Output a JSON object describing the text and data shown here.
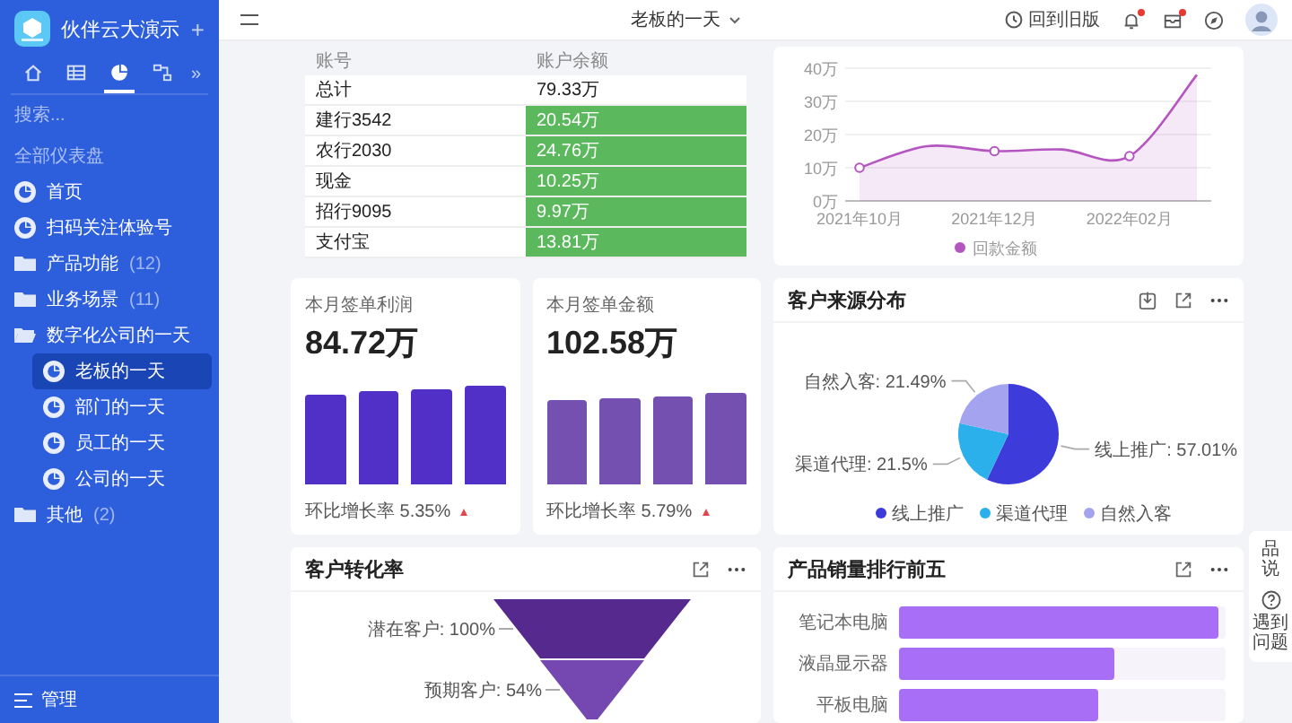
{
  "sidebar": {
    "brand": "伙伴云大演示",
    "add": "+",
    "tabs": [
      {
        "kind": "home",
        "selected": false
      },
      {
        "kind": "table",
        "selected": false
      },
      {
        "kind": "pie",
        "selected": true
      },
      {
        "kind": "flow",
        "selected": false
      }
    ],
    "more": "»",
    "search": {
      "placeholder": "搜索..."
    },
    "section": "全部仪表盘",
    "items": [
      {
        "kind": "dashboard",
        "label": "首页",
        "selected": false
      },
      {
        "kind": "dashboard",
        "label": "扫码关注体验号",
        "selected": false
      },
      {
        "kind": "folder",
        "label": "产品功能",
        "count": "(12)",
        "expanded": false
      },
      {
        "kind": "folder",
        "label": "业务场景",
        "count": "(11)",
        "expanded": false
      },
      {
        "kind": "folder",
        "label": "数字化公司的一天",
        "expanded": true,
        "children": [
          {
            "kind": "dashboard",
            "label": "老板的一天",
            "selected": true
          },
          {
            "kind": "dashboard",
            "label": "部门的一天",
            "selected": false
          },
          {
            "kind": "dashboard",
            "label": "员工的一天",
            "selected": false
          },
          {
            "kind": "dashboard",
            "label": "公司的一天",
            "selected": false
          }
        ]
      },
      {
        "kind": "folder",
        "label": "其他",
        "count": "(2)",
        "expanded": false
      }
    ],
    "footer": "管理"
  },
  "topbar": {
    "title": "老板的一天",
    "old_version": "回到旧版",
    "bell_badge": true,
    "inbox_badge": true
  },
  "balance_table": {
    "columns": [
      "账号",
      "账户余额"
    ],
    "rows": [
      {
        "account": "总计",
        "balance": "79.33万",
        "highlighted": false
      },
      {
        "account": "建行3542",
        "balance": "20.54万",
        "highlighted": true
      },
      {
        "account": "农行2030",
        "balance": "24.76万",
        "highlighted": true
      },
      {
        "account": "现金",
        "balance": "10.25万",
        "highlighted": true
      },
      {
        "account": "招行9095",
        "balance": "9.97万",
        "highlighted": true
      },
      {
        "account": "支付宝",
        "balance": "13.81万",
        "highlighted": true
      }
    ]
  },
  "payment_chart": {
    "chart_data": {
      "type": "area",
      "grid": true,
      "categories": [
        "2021年10月",
        null,
        "2021年12月",
        null,
        "2022年02月",
        null
      ],
      "ylim": [
        0,
        40
      ],
      "yticks": [
        {
          "value": 0,
          "label": "0万"
        },
        {
          "value": 10,
          "label": "10万"
        },
        {
          "value": 20,
          "label": "20万"
        },
        {
          "value": 30,
          "label": "30万"
        },
        {
          "value": 40,
          "label": "40万"
        }
      ],
      "series": [
        {
          "name": "回款金额",
          "color": "#b455c0",
          "values": [
            10,
            16.5,
            15,
            15.5,
            13.5,
            38
          ]
        }
      ]
    }
  },
  "kpis": [
    {
      "title": "本月签单利润",
      "value": "84.72万",
      "color": "#5130c8",
      "footer": "环比增长率 5.35%",
      "rising": true
    },
    {
      "title": "本月签单金额",
      "value": "102.58万",
      "color": "#7450b0",
      "footer": "环比增长率 5.79%",
      "rising": true
    }
  ],
  "source_chart": {
    "title": "客户来源分布",
    "actions": [
      {
        "kind": "download"
      },
      {
        "kind": "expand"
      },
      {
        "kind": "more"
      }
    ],
    "chart_data": {
      "type": "pie",
      "categories": [
        "线上推广",
        "渠道代理",
        "自然入客"
      ],
      "values": [
        57.01,
        21.5,
        21.49
      ],
      "value_labels": [
        "线上推广: 57.01%",
        "渠道代理: 21.5%",
        "自然入客: 21.49%"
      ],
      "legend": "bottom"
    }
  },
  "funnel": {
    "title": "客户转化率",
    "actions": [
      {
        "kind": "expand"
      },
      {
        "kind": "more"
      }
    ],
    "stages": [
      {
        "label": "潜在客户: 100%",
        "color": "#56298f"
      },
      {
        "label": "预期客户: 54%",
        "color": "#7448b0"
      }
    ]
  },
  "top_products": {
    "title": "产品销量排行前五",
    "actions": [
      {
        "kind": "expand"
      },
      {
        "kind": "more"
      }
    ],
    "items": [
      {
        "label": "笔记本电脑",
        "level": 0.98
      },
      {
        "label": "液晶显示器",
        "level": 0.66
      },
      {
        "label": "平板电脑",
        "level": 0.61
      }
    ]
  },
  "side_widget": {
    "feedback": "品说",
    "help": "遇到问题"
  }
}
